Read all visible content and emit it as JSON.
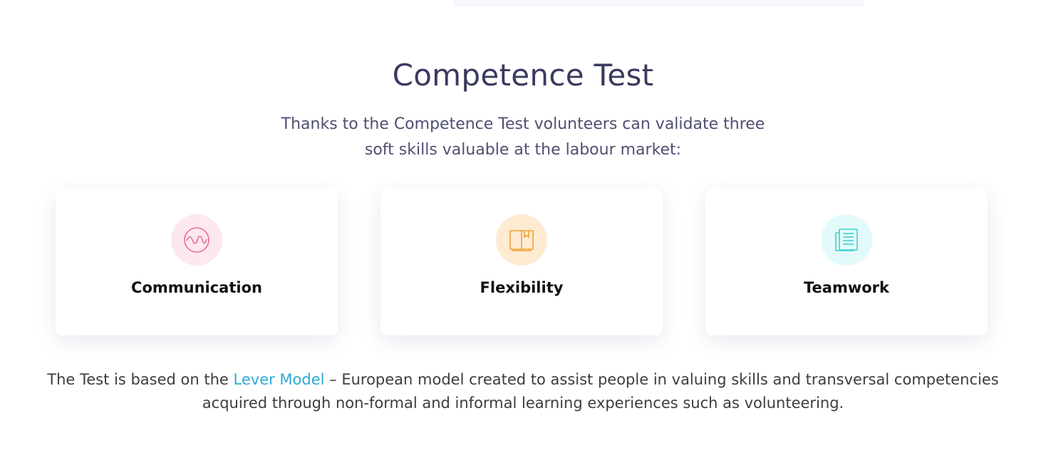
{
  "section": {
    "title": "Competence Test",
    "subtitle": "Thanks to the Competence Test volunteers can validate three soft skills valuable at the labour market:"
  },
  "cards": [
    {
      "label": "Communication",
      "icon": "wave-circle-icon",
      "icon_color": "#e46b9c",
      "icon_bg": "#fde8ef"
    },
    {
      "label": "Flexibility",
      "icon": "open-book-icon",
      "icon_color": "#f0a139",
      "icon_bg": "#fdebd2"
    },
    {
      "label": "Teamwork",
      "icon": "document-list-icon",
      "icon_color": "#3fcfd3",
      "icon_bg": "#e3fafa"
    }
  ],
  "footer": {
    "text_before": "The Test is based on the ",
    "link_text": "Lever Model",
    "text_after": " – European model created to assist people in valuing skills and transversal competencies acquired through non-formal and informal learning experiences such as volunteering.",
    "link_color": "#2ea9d6"
  }
}
